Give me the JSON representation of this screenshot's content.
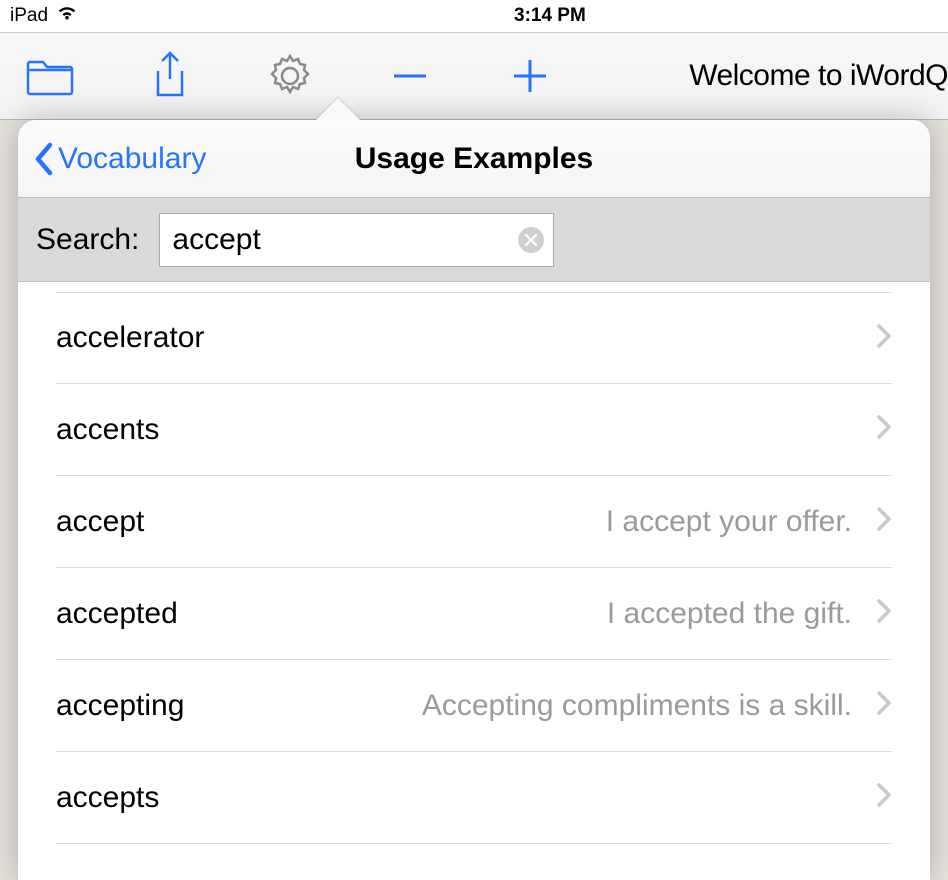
{
  "status": {
    "device": "iPad",
    "time": "3:14 PM"
  },
  "toolbar": {
    "doc_title": "Welcome to iWordQ"
  },
  "popover": {
    "back_label": "Vocabulary",
    "title": "Usage Examples",
    "search_label": "Search:",
    "search_value": "accept",
    "rows": [
      {
        "word": "accelerator",
        "example": ""
      },
      {
        "word": "accents",
        "example": ""
      },
      {
        "word": "accept",
        "example": "I accept your offer."
      },
      {
        "word": "accepted",
        "example": "I accepted the gift."
      },
      {
        "word": "accepting",
        "example": "Accepting compliments is a skill."
      },
      {
        "word": "accepts",
        "example": ""
      }
    ]
  }
}
